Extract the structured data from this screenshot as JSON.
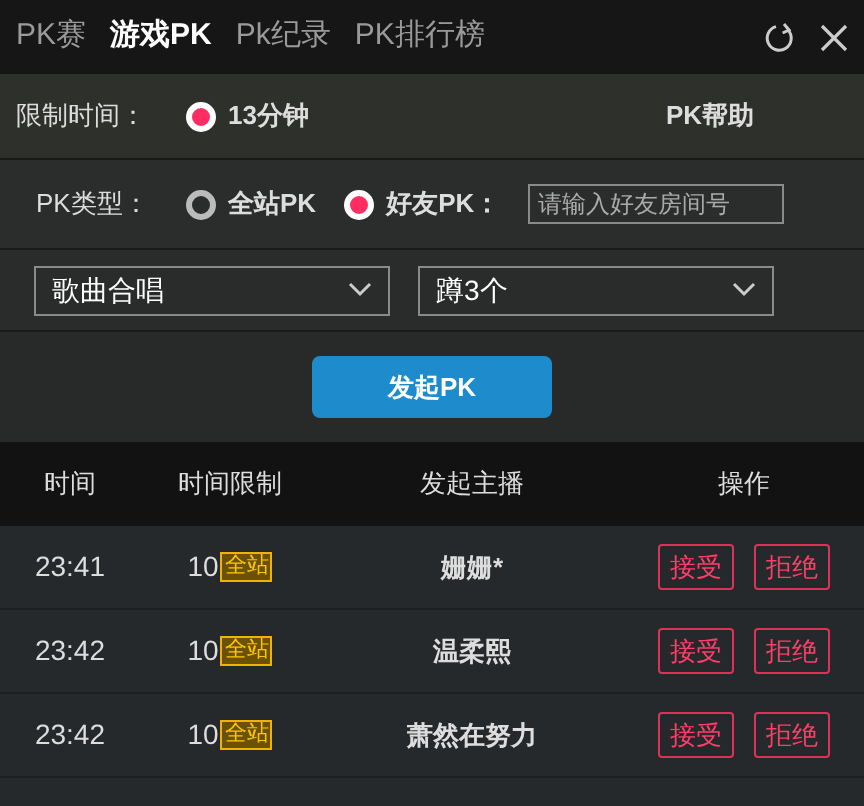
{
  "tabs": [
    {
      "label": "PK赛",
      "selected": false
    },
    {
      "label": "游戏PK",
      "selected": true
    },
    {
      "label": "Pk纪录",
      "selected": false
    },
    {
      "label": "PK排行榜",
      "selected": false
    }
  ],
  "time_limit": {
    "label": "限制时间：",
    "options": [
      {
        "label": "13分钟",
        "selected": true
      }
    ],
    "help": "PK帮助"
  },
  "pk_type": {
    "label": "PK类型：",
    "options": [
      {
        "label": "全站PK",
        "selected": false
      },
      {
        "label": "好友PK：",
        "selected": true
      }
    ],
    "room_field": {
      "placeholder": "请输入好友房间号"
    }
  },
  "selects": [
    {
      "value": "歌曲合唱"
    },
    {
      "value": "蹲3个"
    }
  ],
  "start_button": "发起PK",
  "table": {
    "columns": [
      "时间",
      "时间限制",
      "发起主播",
      "操作"
    ],
    "rows": [
      {
        "time": "23:41",
        "limit": "10",
        "scope": "全站",
        "host": "姗姗*",
        "accept": "接受",
        "reject": "拒绝"
      },
      {
        "time": "23:42",
        "limit": "10",
        "scope": "全站",
        "host": "温柔熙",
        "accept": "接受",
        "reject": "拒绝"
      },
      {
        "time": "23:42",
        "limit": "10",
        "scope": "全站",
        "host": "萧然在努力",
        "accept": "接受",
        "reject": "拒绝"
      }
    ]
  }
}
